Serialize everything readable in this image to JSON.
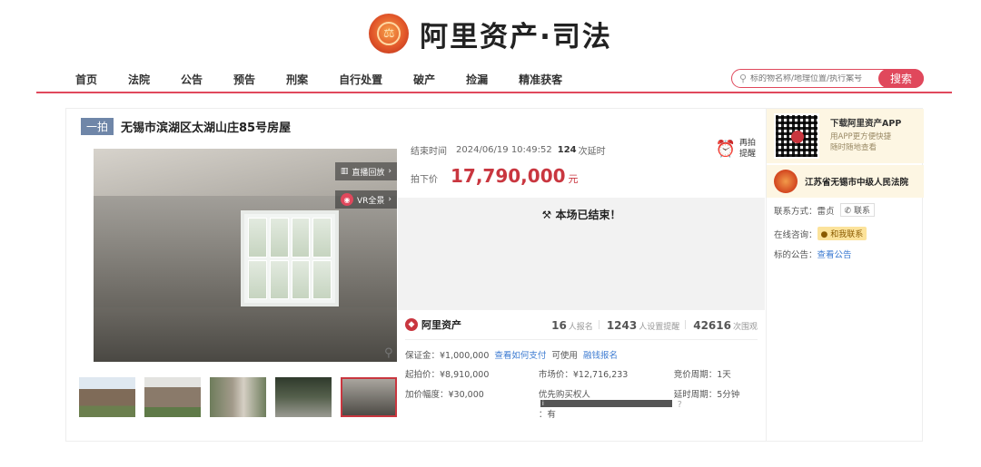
{
  "header": {
    "brand": "阿里资产·司法",
    "nav": [
      "首页",
      "法院",
      "公告",
      "预告",
      "刑案",
      "自行处置",
      "破产",
      "捡漏",
      "精准获客"
    ],
    "search_placeholder": "标的物名称/地理位置/执行案号",
    "search_button": "搜索"
  },
  "item": {
    "tag": "一拍",
    "title": "无锡市滨湖区太湖山庄85号房屋",
    "live_replay": "直播回放",
    "vr": "VR全景",
    "thumbnails": [
      "house-front",
      "house-side",
      "gate",
      "courtyard",
      "room-interior"
    ]
  },
  "auction": {
    "end_label": "结束时间",
    "end_time": "2024/06/19 10:49:52",
    "extend_count": "124",
    "extend_label": "次延时",
    "remind_text": [
      "再拍",
      "提醒"
    ],
    "deal_label": "拍下价",
    "deal_price": "17,790,000",
    "currency": "元",
    "ended": "本场已结束！",
    "platform": "阿里资产",
    "signups": "16",
    "signups_label": "人报名",
    "reminders": "1243",
    "reminders_label": "人设置提醒",
    "views": "42616",
    "views_label": "次围观",
    "deposit": "保证金：¥1,000,000",
    "deposit_link": "查看如何支付",
    "usable": "可使用",
    "loan_link": "融钱报名",
    "start_price": "起拍价：¥8,910,000",
    "market_price": "市场价：¥12,716,233",
    "cycle": "竞价周期：1天",
    "increment": "加价幅度：¥30,000",
    "priority_label": "优先购买权人",
    "priority_value": "：有",
    "delay": "延时周期：5分钟"
  },
  "sidebar": {
    "app_title": "下载阿里资产APP",
    "app_desc": [
      "用APP更方便快捷",
      "随时随地查看"
    ],
    "court": "江苏省无锡市中级人民法院",
    "contact_label": "联系方式：",
    "contact_name": "雷贞",
    "contact_btn": "联系",
    "consult_label": "在线咨询：",
    "consult_btn": "和我联系",
    "notice_label": "标的公告：",
    "notice_link": "查看公告"
  }
}
